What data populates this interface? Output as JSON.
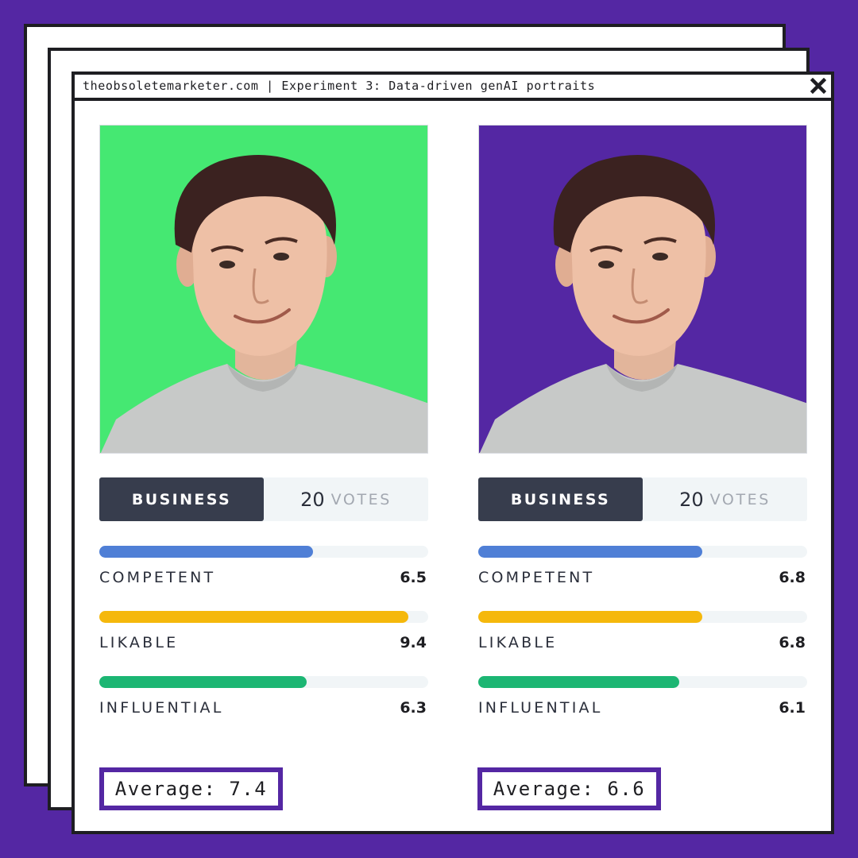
{
  "window": {
    "title": "theobsoletemarketer.com | Experiment 3: Data-driven genAI portraits",
    "close_icon": "close-icon"
  },
  "colors": {
    "page_background": "#5427a3",
    "competent": "#4f7fd6",
    "likable": "#f5b80c",
    "influential": "#1cb673"
  },
  "portraits": [
    {
      "background": "#45e872",
      "category": "BUSINESS",
      "votes_count": "20",
      "votes_label": "VOTES",
      "metrics": [
        {
          "label": "COMPETENT",
          "value": "6.5",
          "score": 6.5
        },
        {
          "label": "LIKABLE",
          "value": "9.4",
          "score": 9.4
        },
        {
          "label": "INFLUENTIAL",
          "value": "6.3",
          "score": 6.3
        }
      ],
      "average": "Average: 7.4"
    },
    {
      "background": "#5427a3",
      "category": "BUSINESS",
      "votes_count": "20",
      "votes_label": "VOTES",
      "metrics": [
        {
          "label": "COMPETENT",
          "value": "6.8",
          "score": 6.8
        },
        {
          "label": "LIKABLE",
          "value": "6.8",
          "score": 6.8
        },
        {
          "label": "INFLUENTIAL",
          "value": "6.1",
          "score": 6.1
        }
      ],
      "average": "Average: 6.6"
    }
  ]
}
